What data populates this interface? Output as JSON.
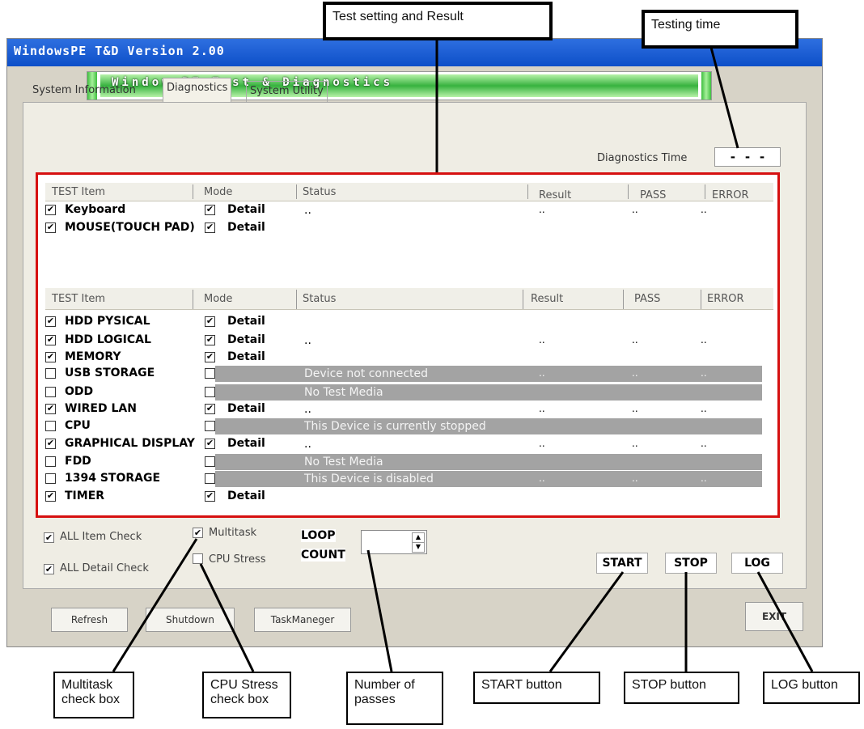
{
  "window": {
    "title": "WindowsPE T&D Version 2.00"
  },
  "banner": {
    "text": "WindowsPE Test & Diagnostics"
  },
  "tabs": [
    {
      "label": "System Information"
    },
    {
      "label": "Diagnostics"
    },
    {
      "label": "System Utility"
    }
  ],
  "diagnostics_time": {
    "label": "Diagnostics Time",
    "value": "- - -"
  },
  "table_headers": {
    "item": "TEST Item",
    "mode": "Mode",
    "status": "Status",
    "result": "Result",
    "pass": "PASS",
    "error": "ERROR"
  },
  "upper_rows": [
    {
      "name": "Keyboard",
      "checked": true,
      "mode_checked": true,
      "mode": "Detail",
      "status": "..",
      "result": "..",
      "pass": "..",
      "error": ".."
    },
    {
      "name": "MOUSE(TOUCH PAD)",
      "checked": true,
      "mode_checked": true,
      "mode": "Detail",
      "status": "",
      "result": "",
      "pass": "",
      "error": ""
    }
  ],
  "lower_rows": [
    {
      "name": "HDD PYSICAL",
      "checked": true,
      "mode_checked": true,
      "mode": "Detail",
      "status": "",
      "result": "",
      "pass": "",
      "error": "",
      "disabled": false
    },
    {
      "name": "HDD LOGICAL",
      "checked": true,
      "mode_checked": true,
      "mode": "Detail",
      "status": "..",
      "result": "..",
      "pass": "..",
      "error": "..",
      "disabled": false
    },
    {
      "name": "MEMORY",
      "checked": true,
      "mode_checked": true,
      "mode": "Detail",
      "status": "",
      "result": "",
      "pass": "",
      "error": "",
      "disabled": false
    },
    {
      "name": "USB STORAGE",
      "checked": false,
      "mode_checked": false,
      "mode": "",
      "status": "Device not connected",
      "result": "..",
      "pass": "..",
      "error": "..",
      "disabled": true
    },
    {
      "name": "ODD",
      "checked": false,
      "mode_checked": false,
      "mode": "",
      "status": "No Test Media",
      "result": "",
      "pass": "",
      "error": "",
      "disabled": true
    },
    {
      "name": "WIRED LAN",
      "checked": true,
      "mode_checked": false,
      "mode": "Detail",
      "status": "..",
      "result": "..",
      "pass": "..",
      "error": "..",
      "disabled": false
    },
    {
      "name": "CPU",
      "checked": false,
      "mode_checked": false,
      "mode": "",
      "status": "This Device is currently stopped",
      "result": "",
      "pass": "",
      "error": "",
      "disabled": true
    },
    {
      "name": "GRAPHICAL DISPLAY",
      "checked": true,
      "mode_checked": true,
      "mode": "Detail",
      "status": "..",
      "result": "..",
      "pass": "..",
      "error": "..",
      "disabled": false
    },
    {
      "name": "FDD",
      "checked": false,
      "mode_checked": false,
      "mode": "",
      "status": "No Test Media",
      "result": "",
      "pass": "",
      "error": "",
      "disabled": true
    },
    {
      "name": "1394 STORAGE",
      "checked": false,
      "mode_checked": false,
      "mode": "",
      "status": "This Device is disabled",
      "result": "..",
      "pass": "..",
      "error": "..",
      "disabled": true
    },
    {
      "name": "TIMER",
      "checked": true,
      "mode_checked": true,
      "mode": "Detail",
      "status": "",
      "result": "",
      "pass": "",
      "error": "",
      "disabled": false
    }
  ],
  "options": {
    "all_item_check": "ALL Item Check",
    "all_detail_check": "ALL Detail Check",
    "multitask": "Multitask",
    "cpu_stress": "CPU Stress",
    "loop_count_line1": "LOOP",
    "loop_count_line2": "COUNT",
    "loop_count_value": ""
  },
  "buttons": {
    "start": "START",
    "stop": "STOP",
    "log": "LOG",
    "refresh": "Refresh",
    "shutdown": "Shutdown",
    "taskmanager": "TaskManeger",
    "exit": "EXIT"
  },
  "callouts": {
    "test_setting": "Test setting and Result",
    "testing_time": "Testing time",
    "multitask": "Multitask check box",
    "cpu_stress": "CPU Stress check box",
    "passes": "Number of passes",
    "start": "START button",
    "stop": "STOP button",
    "log": "LOG button"
  }
}
